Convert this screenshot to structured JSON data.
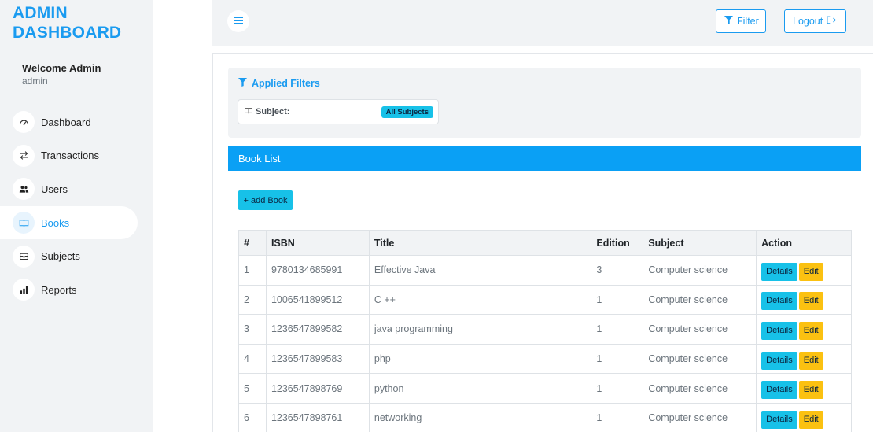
{
  "sidebar": {
    "brand_line1": "ADMIN",
    "brand_line2": "DASHBOARD",
    "welcome": "Welcome Admin",
    "username": "admin",
    "items": [
      {
        "label": "Dashboard",
        "icon": "gauge-icon"
      },
      {
        "label": "Transactions",
        "icon": "arrows-exchange-icon"
      },
      {
        "label": "Users",
        "icon": "users-icon"
      },
      {
        "label": "Books",
        "icon": "book-icon",
        "active": true
      },
      {
        "label": "Subjects",
        "icon": "inbox-tray-icon"
      },
      {
        "label": "Reports",
        "icon": "bar-chart-icon"
      }
    ]
  },
  "header": {
    "menu_icon": "hamburger-icon",
    "filter_label": "Filter",
    "logout_label": "Logout"
  },
  "filters": {
    "title": "Applied Filters",
    "subject_label": "Subject:",
    "subject_value": "All Subjects"
  },
  "book_list": {
    "title": "Book List",
    "add_label": "+ add Book",
    "columns": [
      "#",
      "ISBN",
      "Title",
      "Edition",
      "Subject",
      "Action"
    ],
    "details_label": "Details",
    "edit_label": "Edit",
    "rows": [
      {
        "num": "1",
        "isbn": "9780134685991",
        "title": "Effective Java",
        "edition": "3",
        "subject": "Computer science"
      },
      {
        "num": "2",
        "isbn": "1006541899512",
        "title": "C ++",
        "edition": "1",
        "subject": "Computer science"
      },
      {
        "num": "3",
        "isbn": "1236547899582",
        "title": "java programming",
        "edition": "1",
        "subject": "Computer science"
      },
      {
        "num": "4",
        "isbn": "1236547899583",
        "title": "php",
        "edition": "1",
        "subject": "Computer science"
      },
      {
        "num": "5",
        "isbn": "1236547898769",
        "title": "python",
        "edition": "1",
        "subject": "Computer science"
      },
      {
        "num": "6",
        "isbn": "1236547898761",
        "title": "networking",
        "edition": "1",
        "subject": "Computer science"
      }
    ]
  },
  "colors": {
    "accent": "#1a9bf0",
    "bar_blue": "#0aa0f5",
    "info": "#17c1e8",
    "warning": "#fbc111",
    "panel_bg": "#f1f3f5"
  }
}
